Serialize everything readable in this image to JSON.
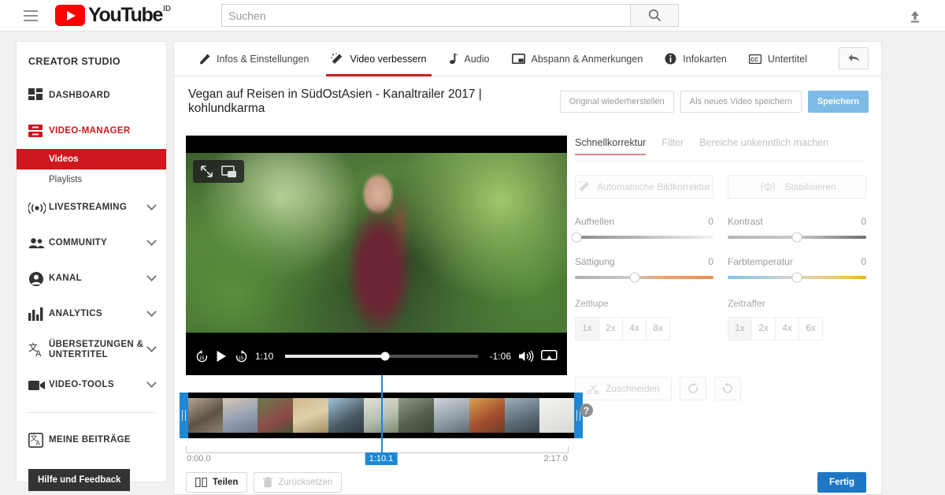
{
  "header": {
    "logo_word": "YouTube",
    "logo_sup": "ID",
    "search_placeholder": "Suchen",
    "search_value": "",
    "menu_icon": "hamburger-icon",
    "search_icon": "search-icon",
    "upload_icon": "upload-icon"
  },
  "sidebar": {
    "title": "CREATOR STUDIO",
    "items": [
      {
        "label": "DASHBOARD",
        "icon": "dashboard-icon",
        "expandable": false,
        "active": false
      },
      {
        "label": "VIDEO-MANAGER",
        "icon": "video-manager-icon",
        "expandable": false,
        "active": true
      },
      {
        "label": "LIVESTREAMING",
        "icon": "livestream-icon",
        "expandable": true,
        "active": false
      },
      {
        "label": "COMMUNITY",
        "icon": "community-icon",
        "expandable": true,
        "active": false
      },
      {
        "label": "KANAL",
        "icon": "channel-icon",
        "expandable": true,
        "active": false
      },
      {
        "label": "ANALYTICS",
        "icon": "analytics-icon",
        "expandable": true,
        "active": false
      },
      {
        "label": "ÜBERSETZUNGEN & UNTERTITEL",
        "icon": "translate-icon",
        "expandable": true,
        "active": false
      },
      {
        "label": "VIDEO-TOOLS",
        "icon": "video-tools-icon",
        "expandable": true,
        "active": false
      }
    ],
    "sub_items": [
      {
        "label": "Videos",
        "selected": true
      },
      {
        "label": "Playlists",
        "selected": false
      }
    ],
    "my_contributions": {
      "label": "MEINE BEITRÄGE",
      "icon": "translate-icon"
    },
    "help_button": "Hilfe und Feedback"
  },
  "tabs": [
    {
      "label": "Infos & Einstellungen",
      "icon": "pencil-icon",
      "active": false
    },
    {
      "label": "Video verbessern",
      "icon": "magic-wand-icon",
      "active": true
    },
    {
      "label": "Audio",
      "icon": "music-note-icon",
      "active": false
    },
    {
      "label": "Abspann & Anmerkungen",
      "icon": "endscreen-icon",
      "active": false
    },
    {
      "label": "Infokarten",
      "icon": "info-icon",
      "active": false
    },
    {
      "label": "Untertitel",
      "icon": "cc-icon",
      "active": false
    }
  ],
  "back_button_icon": "back-arrow-icon",
  "video": {
    "title": "Vegan auf Reisen in SüdOstAsien - Kanaltrailer 2017 | kohlundkarma",
    "actions": [
      {
        "label": "Original wiederherstellen",
        "primary": false
      },
      {
        "label": "Als neues Video speichern",
        "primary": false
      },
      {
        "label": "Speichern",
        "primary": true
      }
    ],
    "overlay_icons": [
      "expand-icon",
      "picture-in-picture-icon"
    ],
    "player": {
      "rewind_icon": "rewind-15-icon",
      "play_icon": "play-icon",
      "forward_icon": "forward-15-icon",
      "current_time": "1:10",
      "remaining_time": "-1:06",
      "progress_percent": 52,
      "volume_icon": "volume-icon",
      "cast_icon": "airplay-icon"
    }
  },
  "enhance": {
    "tabs": [
      {
        "label": "Schnellkorrektur",
        "active": true
      },
      {
        "label": "Filter",
        "active": false
      },
      {
        "label": "Bereiche unkenntlich machen",
        "active": false
      }
    ],
    "auto_buttons": [
      {
        "label": "Automatische Bildkorrektur",
        "icon": "magic-wand-icon"
      },
      {
        "label": "Stabilisieren",
        "icon": "stabilize-icon"
      }
    ],
    "sliders": [
      {
        "name": "Aufhellen",
        "value": "0",
        "percent": 0,
        "track": "t-bright"
      },
      {
        "name": "Kontrast",
        "value": "0",
        "percent": 50,
        "track": "t-contrast"
      },
      {
        "name": "Sättigung",
        "value": "0",
        "percent": 43,
        "track": "t-sat"
      },
      {
        "name": "Farbtemperatur",
        "value": "0",
        "percent": 50,
        "track": "t-temp"
      }
    ],
    "speed_groups": [
      {
        "label": "Zeitlupe",
        "options": [
          "1x",
          "2x",
          "4x",
          "8x"
        ],
        "selected": "1x"
      },
      {
        "label": "Zeitraffer",
        "options": [
          "1x",
          "2x",
          "4x",
          "6x"
        ],
        "selected": "1x"
      }
    ],
    "crop_button": {
      "label": "Zuschneiden",
      "icon": "scissors-icon"
    },
    "rotate_buttons": [
      {
        "icon": "rotate-clockwise-icon"
      },
      {
        "icon": "rotate-counterclockwise-icon"
      }
    ]
  },
  "timeline": {
    "start_time": "0:00.0",
    "end_time": "2:17.0",
    "playhead_time": "1:10.1",
    "playhead_percent": 50,
    "help_icon": "help-icon",
    "handle_left_icon": "trim-handle-left",
    "handle_right_icon": "trim-handle-right"
  },
  "bottom": {
    "split_button": {
      "label": "Teilen",
      "icon": "split-icon"
    },
    "reset_button": {
      "label": "Zurücksetzen",
      "icon": "trash-icon"
    },
    "done_button": {
      "label": "Fertig"
    }
  },
  "colors": {
    "brand_red": "#cc181e",
    "accent_blue": "#1e87d6",
    "done_blue": "#1e77c4",
    "save_blue": "#7dbbe6"
  }
}
